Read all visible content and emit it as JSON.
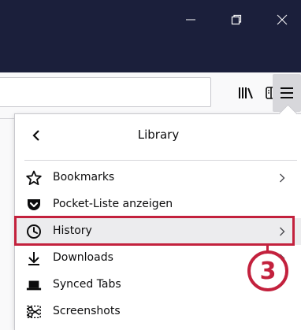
{
  "window": {
    "bg": "#1b1f3b"
  },
  "toolbar": {
    "url_value": "",
    "icons": [
      "library-icon",
      "sidebar-icon",
      "menu-icon"
    ]
  },
  "panel": {
    "title": "Library",
    "back_icon": "chevron-left-icon",
    "items": [
      {
        "label": "Bookmarks",
        "icon": "star-icon",
        "has_submenu": true
      },
      {
        "label": "Pocket-Liste anzeigen",
        "icon": "pocket-icon",
        "has_submenu": false
      },
      {
        "label": "History",
        "icon": "clock-icon",
        "has_submenu": true,
        "highlighted": true
      },
      {
        "label": "Downloads",
        "icon": "download-icon",
        "has_submenu": true
      },
      {
        "label": "Synced Tabs",
        "icon": "laptop-icon",
        "has_submenu": false
      },
      {
        "label": "Screenshots",
        "icon": "scissors-icon",
        "has_submenu": false
      }
    ]
  },
  "annotation": {
    "step": "3",
    "color": "#c3213d"
  }
}
